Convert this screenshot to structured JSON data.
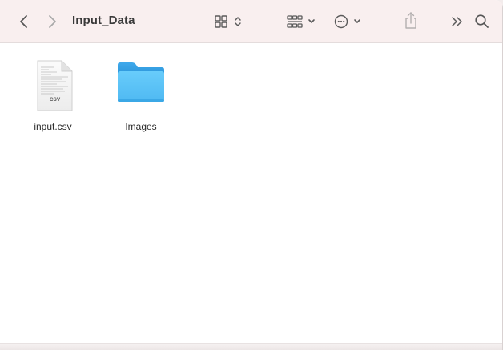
{
  "window": {
    "title": "Input_Data"
  },
  "toolbar": {
    "back_icon": "chevron-left-icon",
    "forward_icon": "chevron-right-icon",
    "view_icon": "grid-view-icon",
    "group_icon": "group-icon",
    "action_icon": "ellipsis-circle-icon",
    "share_icon": "share-icon",
    "more_icon": "double-chevron-icon",
    "search_icon": "search-icon"
  },
  "files": [
    {
      "name": "input.csv",
      "type": "csv",
      "badge": "CSV"
    },
    {
      "name": "Images",
      "type": "folder"
    }
  ],
  "colors": {
    "toolbar_bg": "#f9efef",
    "folder_light": "#5fc4f8",
    "folder_dark": "#2a9ee0",
    "icon_gray": "#6b6b6b"
  }
}
